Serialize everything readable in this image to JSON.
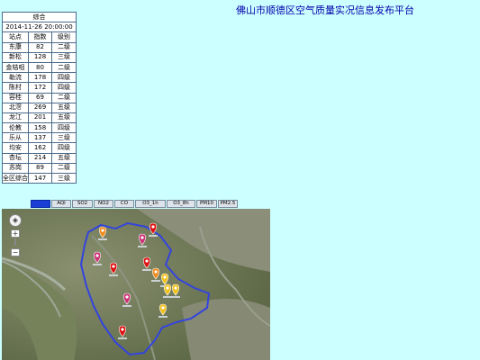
{
  "page": {
    "title": "佛山市顺德区空气质量实况信息发布平台"
  },
  "table": {
    "section": "综合",
    "timestamp": "2014-11-26 20:00:00",
    "headers": [
      "站点",
      "指数",
      "级别"
    ],
    "rows": [
      [
        "东康",
        "82",
        "二级"
      ],
      [
        "新松",
        "128",
        "三级"
      ],
      [
        "金桔咀",
        "80",
        "二级"
      ],
      [
        "勒流",
        "178",
        "四级"
      ],
      [
        "陈村",
        "172",
        "四级"
      ],
      [
        "容桂",
        "69",
        "二级"
      ],
      [
        "北滘",
        "269",
        "五级"
      ],
      [
        "龙江",
        "201",
        "五级"
      ],
      [
        "伦教",
        "158",
        "四级"
      ],
      [
        "乐从",
        "137",
        "三级"
      ],
      [
        "均安",
        "162",
        "四级"
      ],
      [
        "杏坛",
        "214",
        "五级"
      ],
      [
        "苏岗",
        "89",
        "二级"
      ],
      [
        "全区综合",
        "147",
        "三级"
      ]
    ]
  },
  "tabs": [
    "",
    "AQI",
    "SO2",
    "NO2",
    "CO",
    "O3_1h",
    "O3_8h",
    "PM10",
    "PM2.5"
  ],
  "active_tab": 0,
  "map": {
    "zoom_in": "+",
    "zoom_out": "−",
    "pan_icon": "◈",
    "boundary_color": "#3344dd",
    "marker_colors": {
      "red": "#dd1111",
      "pink": "#cc3377",
      "orange": "#f08a1c",
      "yellow": "#f2c21a"
    },
    "markers": [
      {
        "color": "orange",
        "level": "三级"
      },
      {
        "color": "pink",
        "level": "四级"
      },
      {
        "color": "red",
        "level": "五级"
      },
      {
        "color": "pink",
        "level": "四级"
      },
      {
        "color": "red",
        "level": "五级"
      },
      {
        "color": "red",
        "level": "五级"
      },
      {
        "color": "orange",
        "level": "三级"
      },
      {
        "color": "yellow",
        "level": "二级"
      },
      {
        "color": "yellow",
        "level": "二级"
      },
      {
        "color": "yellow",
        "level": "二级"
      },
      {
        "color": "pink",
        "level": "四级"
      },
      {
        "color": "yellow",
        "level": "二级"
      },
      {
        "color": "red",
        "level": "五级"
      }
    ]
  }
}
